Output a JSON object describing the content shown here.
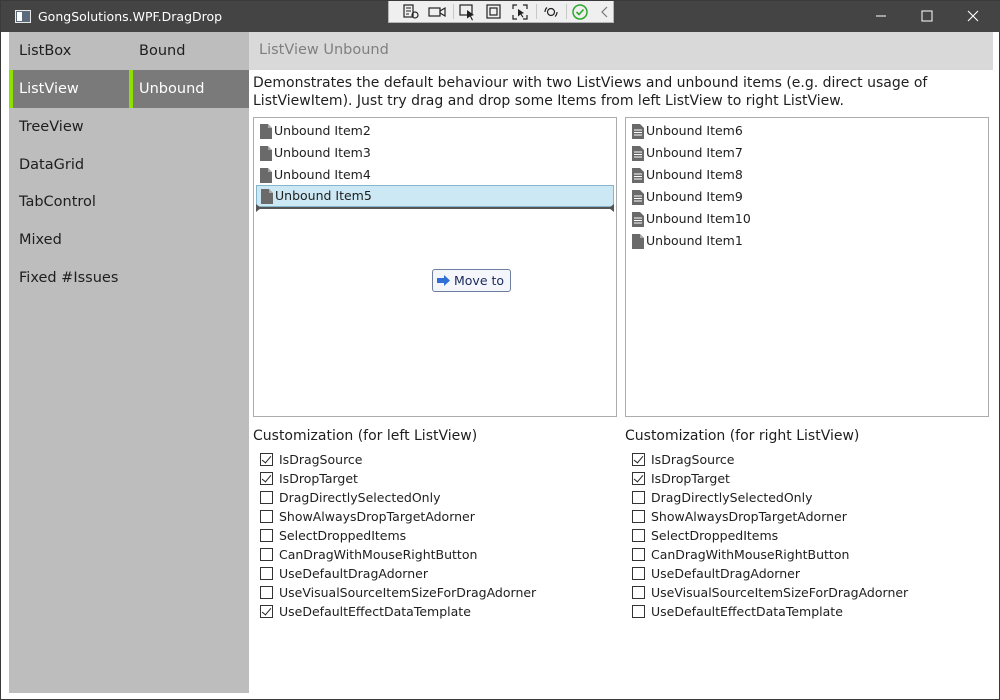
{
  "window": {
    "title": "GongSolutions.WPF.DragDrop",
    "minimize_icon": "minimize-icon",
    "maximize_icon": "maximize-icon",
    "close_icon": "close-icon"
  },
  "debug_toolbar": {
    "icons": [
      "live-visual-tree-icon",
      "camera-icon",
      "select-element-icon",
      "display-layout-adorners-icon",
      "track-focus-icon",
      "hot-reload-icon",
      "checkmark-icon",
      "collapse-chevron-icon"
    ],
    "accent": "#2da82d"
  },
  "nav": {
    "accent": "#8ee000",
    "col1": [
      {
        "label": "ListBox"
      },
      {
        "label": "ListView"
      },
      {
        "label": "TreeView"
      },
      {
        "label": "DataGrid"
      },
      {
        "label": "TabControl"
      },
      {
        "label": "Mixed"
      },
      {
        "label": "Fixed #Issues"
      }
    ],
    "col2": [
      {
        "label": "Bound"
      },
      {
        "label": "Unbound"
      }
    ],
    "selected_col1": "ListView",
    "selected_col2": "Unbound"
  },
  "page": {
    "title": "ListView Unbound",
    "description": "Demonstrates the default behaviour with two ListViews and unbound items (e.g. direct usage of ListViewItem). Just try drag and drop some Items from left ListView to right ListView."
  },
  "left_list": {
    "items": [
      "Unbound Item2",
      "Unbound Item3",
      "Unbound Item4",
      "Unbound Item5"
    ],
    "selected": "Unbound Item5",
    "drag_effect_label": "Move to"
  },
  "right_list": {
    "items": [
      "Unbound Item6",
      "Unbound Item7",
      "Unbound Item8",
      "Unbound Item9",
      "Unbound Item10",
      "Unbound Item1"
    ]
  },
  "customization_left": {
    "title": "Customization (for left ListView)",
    "options": [
      {
        "label": "IsDragSource",
        "checked": true
      },
      {
        "label": "IsDropTarget",
        "checked": true
      },
      {
        "label": "DragDirectlySelectedOnly",
        "checked": false
      },
      {
        "label": "ShowAlwaysDropTargetAdorner",
        "checked": false
      },
      {
        "label": "SelectDroppedItems",
        "checked": false
      },
      {
        "label": "CanDragWithMouseRightButton",
        "checked": false
      },
      {
        "label": "UseDefaultDragAdorner",
        "checked": false
      },
      {
        "label": "UseVisualSourceItemSizeForDragAdorner",
        "checked": false
      },
      {
        "label": "UseDefaultEffectDataTemplate",
        "checked": true
      }
    ]
  },
  "customization_right": {
    "title": "Customization (for right ListView)",
    "options": [
      {
        "label": "IsDragSource",
        "checked": true
      },
      {
        "label": "IsDropTarget",
        "checked": true
      },
      {
        "label": "DragDirectlySelectedOnly",
        "checked": false
      },
      {
        "label": "ShowAlwaysDropTargetAdorner",
        "checked": false
      },
      {
        "label": "SelectDroppedItems",
        "checked": false
      },
      {
        "label": "CanDragWithMouseRightButton",
        "checked": false
      },
      {
        "label": "UseDefaultDragAdorner",
        "checked": false
      },
      {
        "label": "UseVisualSourceItemSizeForDragAdorner",
        "checked": false
      },
      {
        "label": "UseDefaultEffectDataTemplate",
        "checked": false
      }
    ]
  }
}
